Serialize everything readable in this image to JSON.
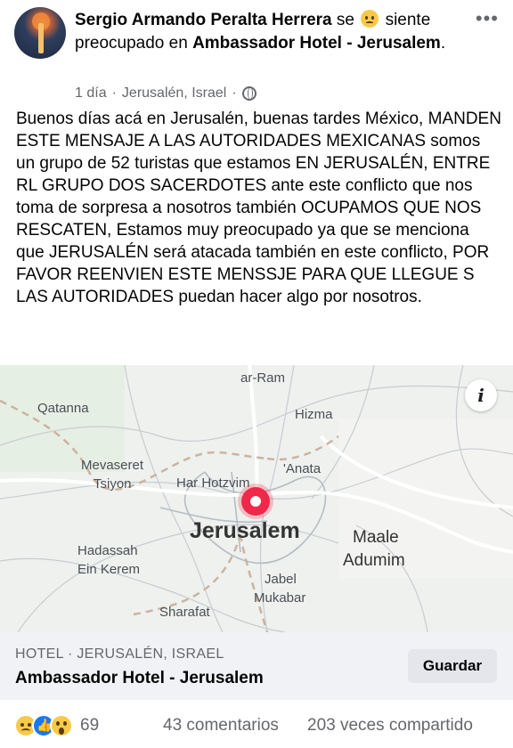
{
  "post": {
    "author": "Sergio Armando Peralta Herrera",
    "feeling_prefix": "se",
    "feeling_text": "siente preocupado en",
    "location": "Ambassador Hotel - Jerusalem",
    "title_end": ".",
    "more_label": "•••",
    "time": "1 día",
    "place": "Jerusalén, Israel",
    "separator": "·",
    "privacy_icon": "globe-icon",
    "body": "Buenos días acá en Jerusalén, buenas tardes México, MANDEN ESTE MENSAJE A LAS AUTORIDADES MEXICANAS somos un grupo de 52 turistas que estamos EN JERUSALÉN, ENTRE RL GRUPO DOS SACERDOTES ante este conflicto que nos toma de sorpresa a nosotros también OCUPAMOS QUE NOS RESCATEN, Estamos muy preocupado ya que se menciona que JERUSALÉN será atacada también en este conflicto, POR FAVOR REENVIEN ESTE MENSSJE PARA QUE LLEGUE S LAS AUTORIDADES puedan hacer algo por nosotros."
  },
  "map": {
    "labels": {
      "ar_ram": "ar-Ram",
      "qatanna": "Qatanna",
      "hizma": "Hizma",
      "mevaseret": "Mevaseret",
      "tsiyon": "Tsiyon",
      "har_hotzvim": "Har Hotzvim",
      "anata": "'Anata",
      "jerusalem": "Jerusalem",
      "maale": "Maale",
      "adumim": "Adumim",
      "hadassah": "Hadassah",
      "ein_kerem": "Ein Kerem",
      "jabel": "Jabel",
      "mukabar": "Mukabar",
      "sharafat": "Sharafat"
    },
    "info_label": "i"
  },
  "place_card": {
    "category": "HOTEL · JERUSALÉN, ISRAEL",
    "name": "Ambassador Hotel - Jerusalem",
    "save_label": "Guardar"
  },
  "footer": {
    "reaction_icons": [
      "sad-icon",
      "like-icon",
      "wow-icon"
    ],
    "reaction_count": "69",
    "comments": "43 comentarios",
    "shares": "203 veces compartido"
  },
  "colors": {
    "pin": "#f02849",
    "like_blue": "#1877f2",
    "secondary_text": "#65676b"
  }
}
